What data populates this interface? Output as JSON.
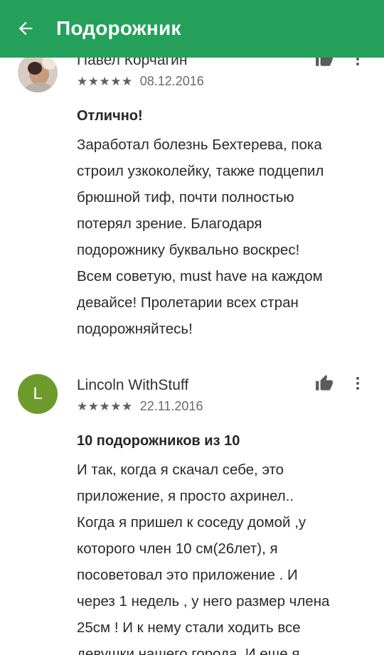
{
  "app_bar": {
    "title": "Подорожник",
    "back_icon": "arrow-back-icon",
    "background": "#24a05a"
  },
  "reviews": [
    {
      "author": "Павел Корчагин",
      "stars": "★★★★★",
      "rating": 5,
      "date": "08.12.2016",
      "title": "Отлично!",
      "body_lines": [
        "Заработал болезнь Бехтерева, пока",
        "строил узкоколейку, также подцепил",
        "брюшной тиф, почти полностью",
        "потерял зрение. Благодаря",
        "подорожнику буквально воскрес!",
        "Всем советую, must have на каждом",
        "девайсе! Пролетарии всех стран",
        "подорожняйтесь!"
      ]
    },
    {
      "author": "Lincoln WithStuff",
      "avatar_letter": "L",
      "avatar_color": "#6c9b2c",
      "stars": "★★★★★",
      "rating": 5,
      "date": "22.11.2016",
      "title": "10 подорожников из 10",
      "body_lines": [
        "И так, когда я скачал себе, это",
        "приложение, я просто ахринел..",
        "Когда я пришел к соседу домой ,у",
        "которого член 10 см(26лет), я",
        "посоветовал это приложение . И",
        "через 1 недель , у него размер члена",
        "25см ! И к нему стали ходить все",
        "девушки нашего города. И еще я"
      ]
    }
  ]
}
